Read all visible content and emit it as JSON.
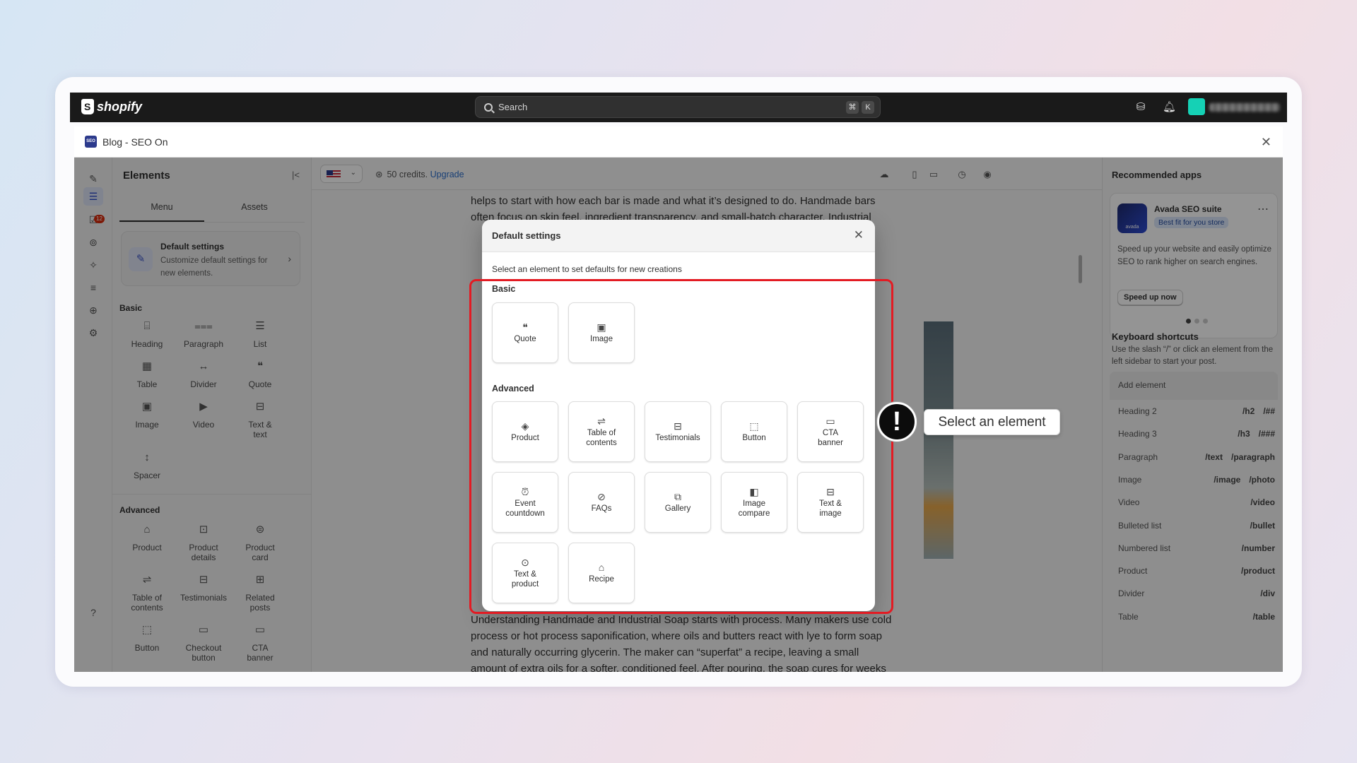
{
  "topbar": {
    "brand": "shopify",
    "search_placeholder": "Search",
    "shortcut_keys": [
      "⌘",
      "K"
    ]
  },
  "app": {
    "badge": "SEO",
    "title": "Blog - SEO On"
  },
  "elements_panel": {
    "title": "Elements",
    "tabs": [
      "Menu",
      "Assets"
    ],
    "default_settings": {
      "title": "Default settings",
      "desc": "Customize default settings for new elements."
    },
    "basic_label": "Basic",
    "basic_items": [
      "Heading",
      "Paragraph",
      "List",
      "Table",
      "Divider",
      "Quote",
      "Image",
      "Video",
      "Text & text",
      "Spacer"
    ],
    "advanced_label": "Advanced",
    "advanced_items": [
      "Product",
      "Product details",
      "Product card",
      "Table of contents",
      "Testimonials",
      "Related posts",
      "Button",
      "Checkout button",
      "CTA banner"
    ],
    "notification_count": "12"
  },
  "editor": {
    "credits": "50 credits.",
    "upgrade": "Upgrade",
    "article_top": [
      "helps to start with how each bar is made and what it’s designed to do. Handmade bars",
      "often focus on skin feel, ingredient transparency, and small-batch character. Industrial"
    ],
    "article_bottom": [
      "Understanding Handmade and Industrial Soap starts with process. Many makers use cold",
      "process or hot process saponification, where oils and butters react with lye to form soap",
      "and naturally occurring glycerin. The maker can “superfat” a recipe, leaving a small",
      "amount of extra oils for a softer, conditioned feel. After pouring, the soap cures for weeks"
    ]
  },
  "right_panel": {
    "recommended_title": "Recommended apps",
    "app_name": "Avada SEO suite",
    "app_badge": "Best fit for you store",
    "app_icon_text": "avada",
    "app_desc": "Speed up your website and easily optimize SEO to rank higher on search engines.",
    "app_button": "Speed up now",
    "shortcuts_title": "Keyboard shortcuts",
    "shortcuts_desc": "Use the slash “/” or click an element from the left sidebar to start your post.",
    "add_element": "Add element",
    "shortcuts": [
      {
        "name": "Heading 2",
        "keys": [
          "/h2",
          "/##"
        ]
      },
      {
        "name": "Heading 3",
        "keys": [
          "/h3",
          "/###"
        ]
      },
      {
        "name": "Paragraph",
        "keys": [
          "/text",
          "/paragraph"
        ]
      },
      {
        "name": "Image",
        "keys": [
          "/image",
          "/photo"
        ]
      },
      {
        "name": "Video",
        "keys": [
          "/video"
        ]
      },
      {
        "name": "Bulleted list",
        "keys": [
          "/bullet"
        ]
      },
      {
        "name": "Numbered list",
        "keys": [
          "/number"
        ]
      },
      {
        "name": "Product",
        "keys": [
          "/product"
        ]
      },
      {
        "name": "Divider",
        "keys": [
          "/div"
        ]
      },
      {
        "name": "Table",
        "keys": [
          "/table"
        ]
      }
    ]
  },
  "modal": {
    "title": "Default settings",
    "subtitle": "Select an element to set defaults for new creations",
    "basic_label": "Basic",
    "basic_tiles": [
      "Quote",
      "Image"
    ],
    "advanced_label": "Advanced",
    "advanced_tiles": [
      "Product",
      "Table of contents",
      "Testimonials",
      "Button",
      "CTA banner",
      "Event countdown",
      "FAQs",
      "Gallery",
      "Image compare",
      "Text & image",
      "Text & product",
      "Recipe"
    ]
  },
  "callout": {
    "text": "Select an element",
    "marker": "!"
  },
  "colors": {
    "highlight": "#e31b23",
    "accent": "#2c6ecb",
    "topbar": "#1a1a1a"
  }
}
